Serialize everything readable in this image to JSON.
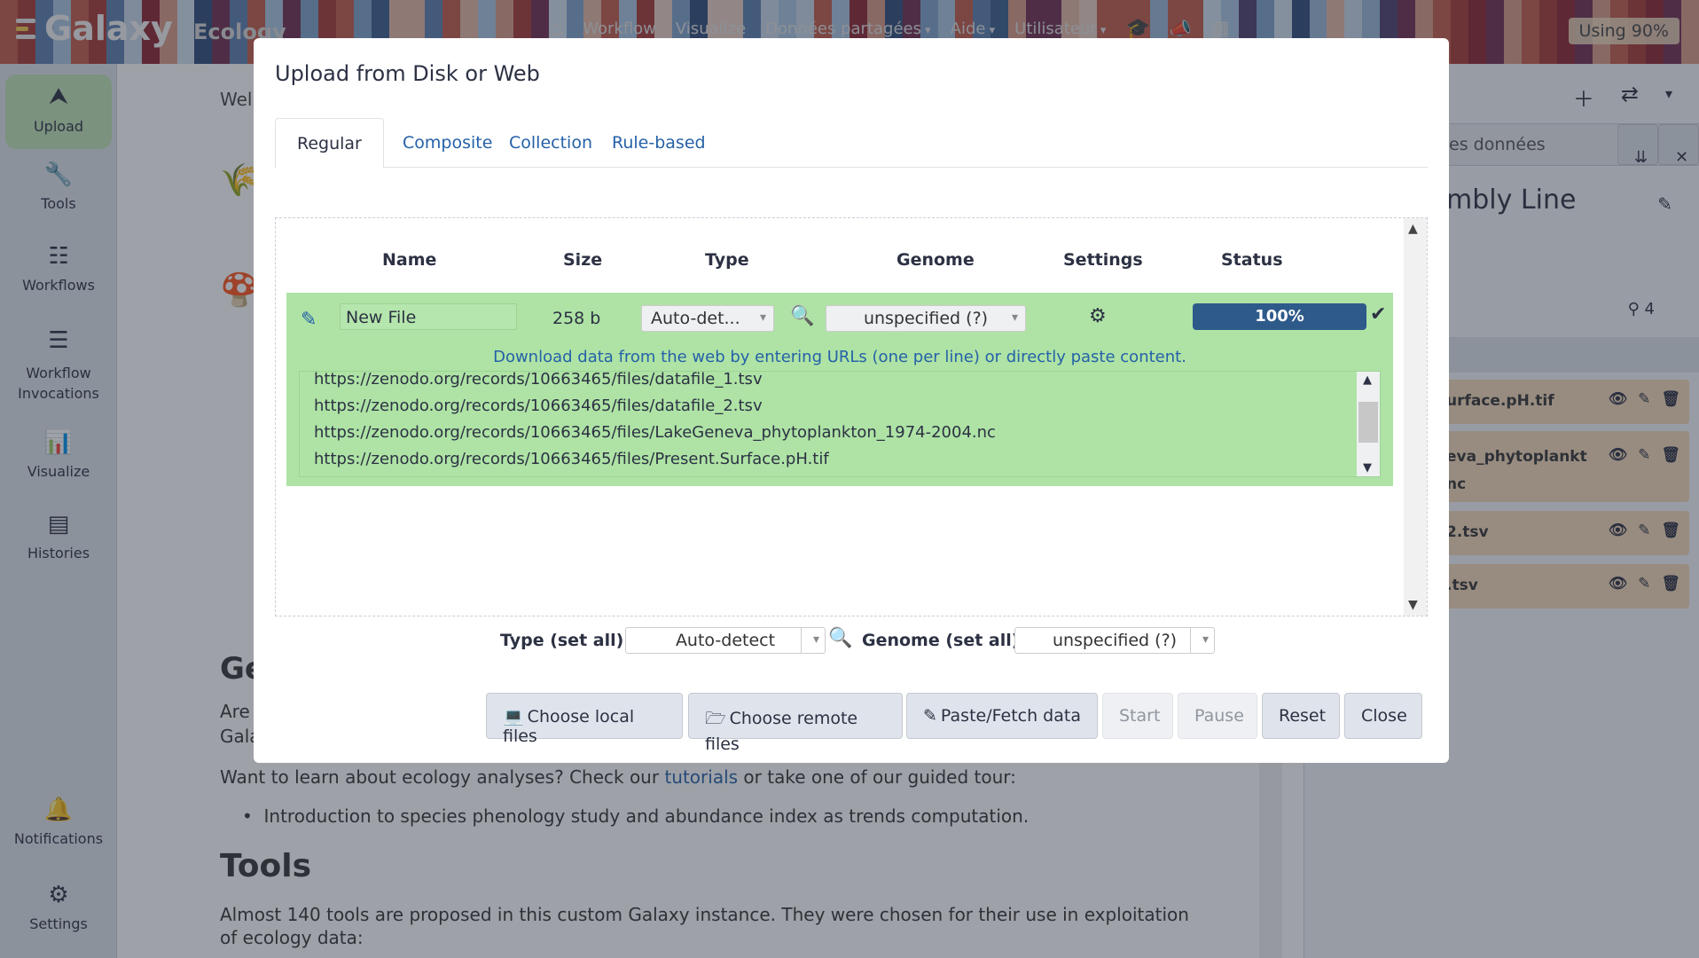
{
  "topbar": {
    "brand": "Galaxy",
    "subbrand": "Ecology",
    "nav": [
      "Workflow",
      "Visualize",
      "Données partagées",
      "Aide",
      "Utilisateur"
    ],
    "usage": "Using 90%"
  },
  "sidebar": {
    "items": [
      {
        "label": "Upload",
        "icon": "upload-icon"
      },
      {
        "label": "Tools",
        "icon": "wrench-icon"
      },
      {
        "label": "Workflows",
        "icon": "sitemap-icon"
      },
      {
        "label": "Workflow Invocations",
        "icon": "list-icon"
      },
      {
        "label": "Visualize",
        "icon": "chart-bar-icon"
      },
      {
        "label": "Histories",
        "icon": "hdd-icon"
      },
      {
        "label": "Notifications",
        "icon": "bell-icon"
      },
      {
        "label": "Settings",
        "icon": "gear-icon"
      }
    ]
  },
  "center": {
    "welcome_fragment": "Wel",
    "heading_fragment": "Ge",
    "para_fragment_1": "Are",
    "para_fragment_2": "Gala",
    "learn_before": "Want to learn about ecology analyses? Check our ",
    "learn_link": "tutorials",
    "learn_after": " or take one of our guided tour:",
    "bullet": "Introduction to species phenology study and abundance index as trends computation.",
    "tools_heading": "Tools",
    "tools_para": "Almost 140 tools are proposed in this custom Galaxy instance. They were chosen for their use in exploitation of ecology data:"
  },
  "history": {
    "search_fragment": "es données",
    "title_fragment": "mbly Line",
    "count": "4",
    "items": [
      {
        "name": "urface.pH.tif"
      },
      {
        "name": "eva_phytoplankt",
        "name2": "nc"
      },
      {
        "name": "2.tsv"
      },
      {
        "name": ".tsv"
      }
    ]
  },
  "modal": {
    "title": "Upload from Disk or Web",
    "tabs": [
      "Regular",
      "Composite",
      "Collection",
      "Rule-based"
    ],
    "columns": [
      "Name",
      "Size",
      "Type",
      "Genome",
      "Settings",
      "Status"
    ],
    "row": {
      "name": "New File",
      "size": "258 b",
      "type": "Auto-det...",
      "genome": "unspecified (?)",
      "status": "100%",
      "progress": 1.0,
      "hint": "Download data from the web by entering URLs (one per line) or directly paste content.",
      "urls": [
        "https://zenodo.org/records/10663465/files/datafile_1.tsv",
        "https://zenodo.org/records/10663465/files/datafile_2.tsv",
        "https://zenodo.org/records/10663465/files/LakeGeneva_phytoplankton_1974-2004.nc",
        "https://zenodo.org/records/10663465/files/Present.Surface.pH.tif"
      ]
    },
    "setall": {
      "type_label": "Type (set all):",
      "type_value": "Auto-detect",
      "genome_label": "Genome (set all):",
      "genome_value": "unspecified (?)"
    },
    "buttons": {
      "local": "Choose local files",
      "remote": "Choose remote files",
      "paste": "Paste/Fetch data",
      "start": "Start",
      "pause": "Pause",
      "reset": "Reset",
      "close": "Close"
    }
  },
  "colors": {
    "row_bg": "#aee3a5",
    "progress": "#2e5a8a",
    "link": "#2561a8"
  }
}
